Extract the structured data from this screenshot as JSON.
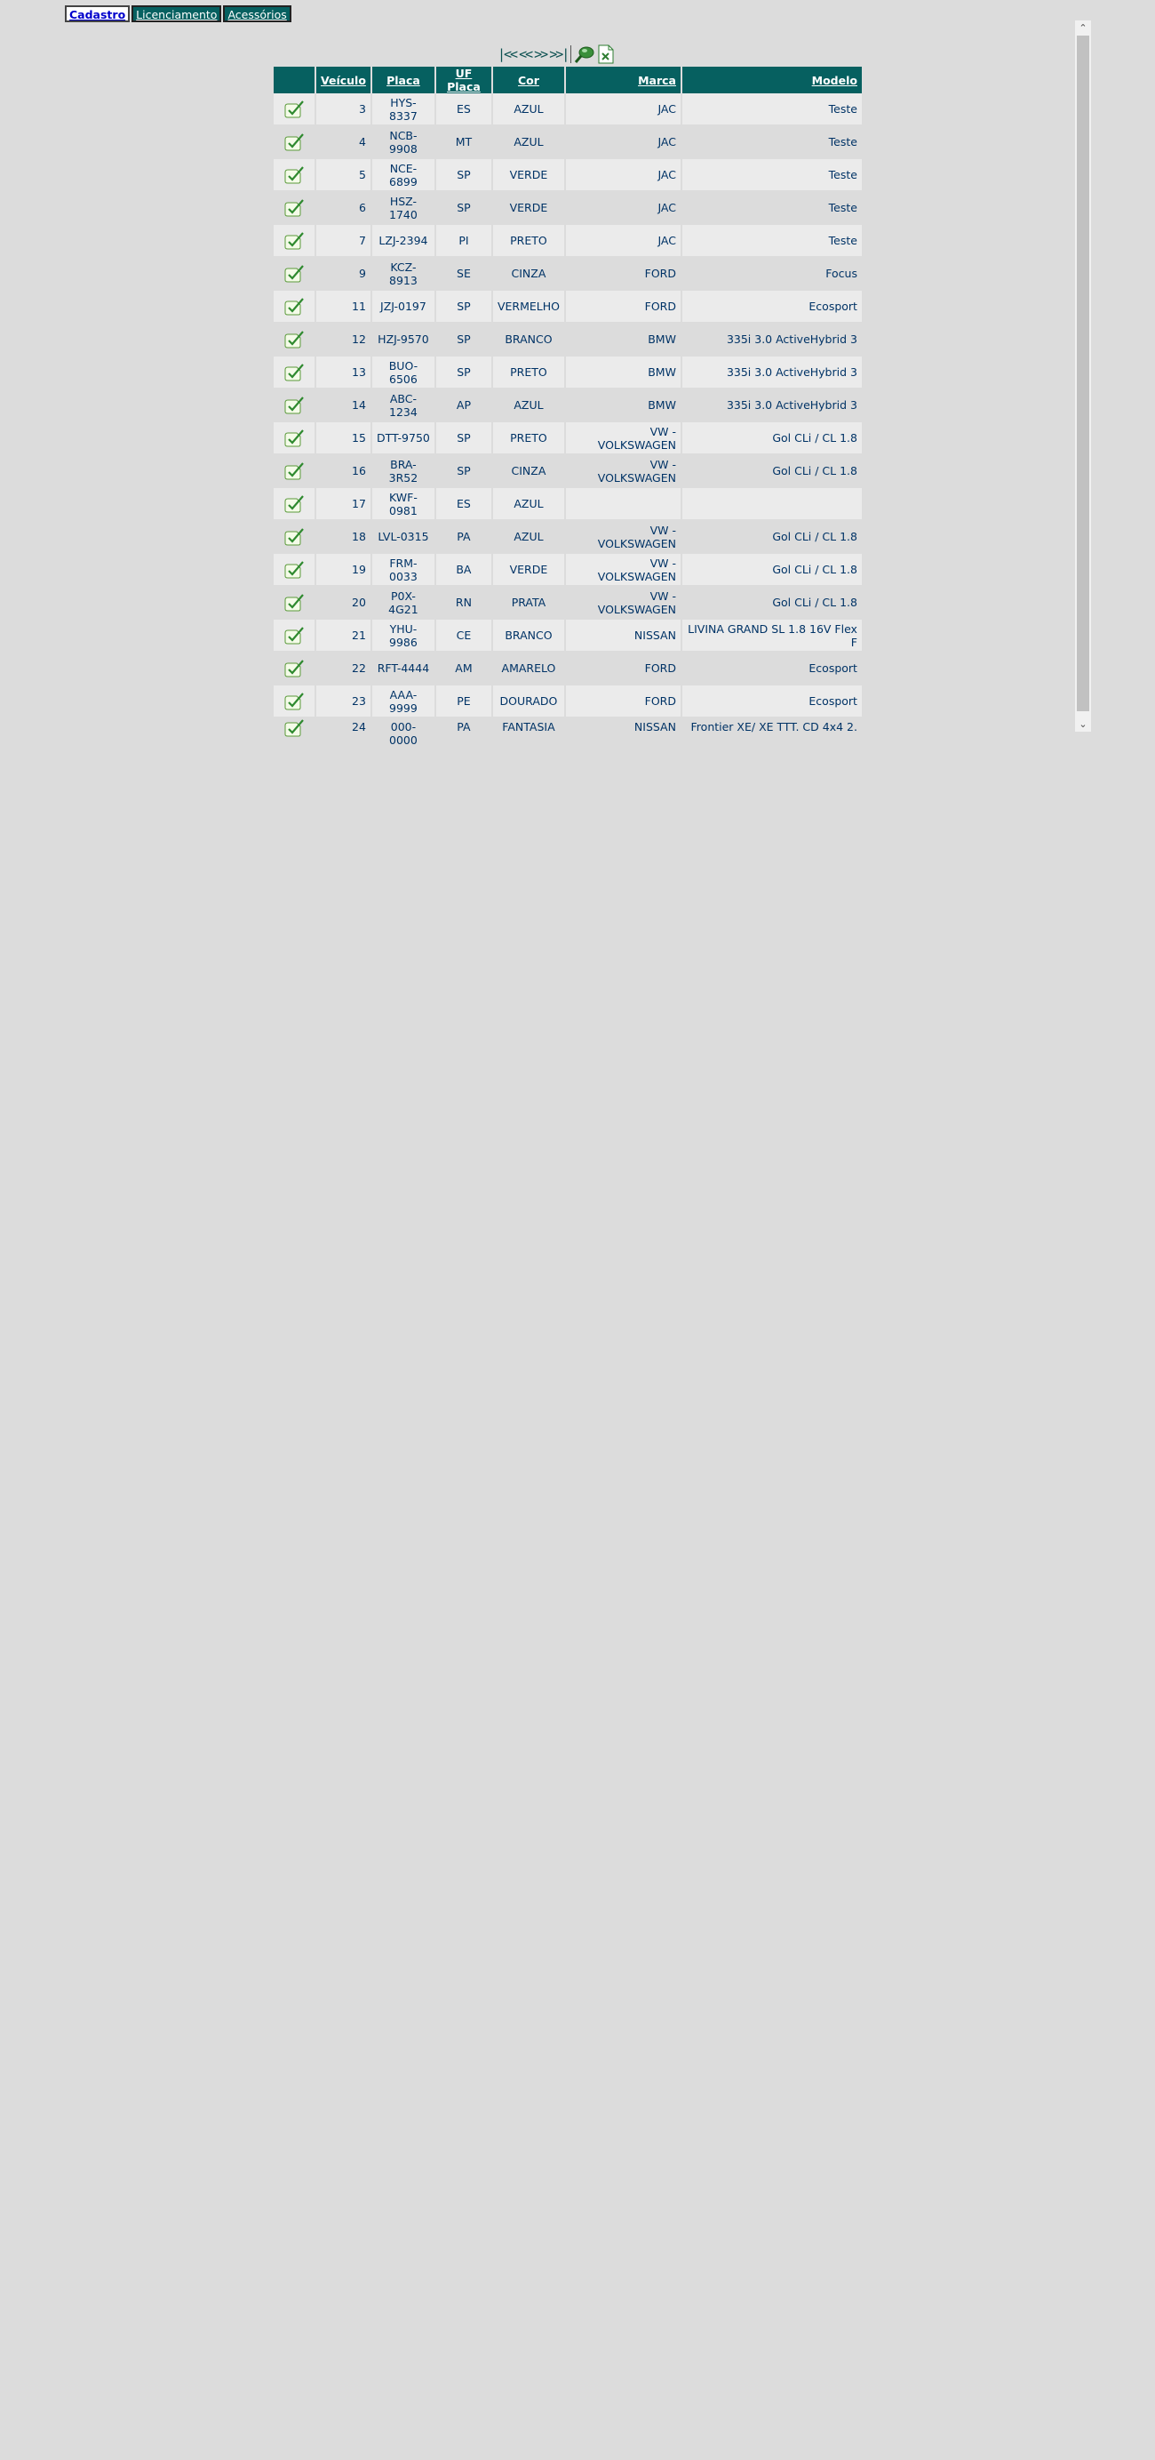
{
  "tabs": [
    {
      "label": "Cadastro",
      "active": true
    },
    {
      "label": "Licenciamento",
      "active": false
    },
    {
      "label": "Acessórios",
      "active": false
    }
  ],
  "pager": {
    "first": "|<<",
    "prev": "<<",
    "next": ">>",
    "last": ">>|",
    "search_icon": "search-icon",
    "export_icon": "excel-export-icon"
  },
  "columns": [
    "",
    "Veículo",
    "Placa",
    "UF Placa",
    "Cor",
    "Marca",
    "Modelo"
  ],
  "rows": [
    {
      "veiculo": "3",
      "placa": "HYS-8337",
      "uf": "ES",
      "cor": "AZUL",
      "marca": "JAC",
      "modelo": "Teste"
    },
    {
      "veiculo": "4",
      "placa": "NCB-9908",
      "uf": "MT",
      "cor": "AZUL",
      "marca": "JAC",
      "modelo": "Teste"
    },
    {
      "veiculo": "5",
      "placa": "NCE-6899",
      "uf": "SP",
      "cor": "VERDE",
      "marca": "JAC",
      "modelo": "Teste"
    },
    {
      "veiculo": "6",
      "placa": "HSZ-1740",
      "uf": "SP",
      "cor": "VERDE",
      "marca": "JAC",
      "modelo": "Teste"
    },
    {
      "veiculo": "7",
      "placa": "LZJ-2394",
      "uf": "PI",
      "cor": "PRETO",
      "marca": "JAC",
      "modelo": "Teste"
    },
    {
      "veiculo": "9",
      "placa": "KCZ-8913",
      "uf": "SE",
      "cor": "CINZA",
      "marca": "FORD",
      "modelo": "Focus"
    },
    {
      "veiculo": "11",
      "placa": "JZJ-0197",
      "uf": "SP",
      "cor": "VERMELHO",
      "marca": "FORD",
      "modelo": "Ecosport"
    },
    {
      "veiculo": "12",
      "placa": "HZJ-9570",
      "uf": "SP",
      "cor": "BRANCO",
      "marca": "BMW",
      "modelo": "335i 3.0 ActiveHybrid 3"
    },
    {
      "veiculo": "13",
      "placa": "BUO-6506",
      "uf": "SP",
      "cor": "PRETO",
      "marca": "BMW",
      "modelo": "335i 3.0 ActiveHybrid 3"
    },
    {
      "veiculo": "14",
      "placa": "ABC-1234",
      "uf": "AP",
      "cor": "AZUL",
      "marca": "BMW",
      "modelo": "335i 3.0 ActiveHybrid 3"
    },
    {
      "veiculo": "15",
      "placa": "DTT-9750",
      "uf": "SP",
      "cor": "PRETO",
      "marca": "VW - VOLKSWAGEN",
      "modelo": "Gol CLi / CL 1.8"
    },
    {
      "veiculo": "16",
      "placa": "BRA-3R52",
      "uf": "SP",
      "cor": "CINZA",
      "marca": "VW - VOLKSWAGEN",
      "modelo": "Gol CLi / CL 1.8"
    },
    {
      "veiculo": "17",
      "placa": "KWF-0981",
      "uf": "ES",
      "cor": "AZUL",
      "marca": "",
      "modelo": ""
    },
    {
      "veiculo": "18",
      "placa": "LVL-0315",
      "uf": "PA",
      "cor": "AZUL",
      "marca": "VW - VOLKSWAGEN",
      "modelo": "Gol CLi / CL 1.8"
    },
    {
      "veiculo": "19",
      "placa": "FRM-0033",
      "uf": "BA",
      "cor": "VERDE",
      "marca": "VW - VOLKSWAGEN",
      "modelo": "Gol CLi / CL 1.8"
    },
    {
      "veiculo": "20",
      "placa": "P0X-4G21",
      "uf": "RN",
      "cor": "PRATA",
      "marca": "VW - VOLKSWAGEN",
      "modelo": "Gol CLi / CL 1.8"
    },
    {
      "veiculo": "21",
      "placa": "YHU-9986",
      "uf": "CE",
      "cor": "BRANCO",
      "marca": "NISSAN",
      "modelo": "LIVINA GRAND SL 1.8 16V Flex F"
    },
    {
      "veiculo": "22",
      "placa": "RFT-4444",
      "uf": "AM",
      "cor": "AMARELO",
      "marca": "FORD",
      "modelo": "Ecosport"
    },
    {
      "veiculo": "23",
      "placa": "AAA-9999",
      "uf": "PE",
      "cor": "DOURADO",
      "marca": "FORD",
      "modelo": "Ecosport"
    },
    {
      "veiculo": "24",
      "placa": "000-0000",
      "uf": "PA",
      "cor": "FANTASIA",
      "marca": "NISSAN",
      "modelo": "Frontier XE/ XE TTT. CD 4x4 2."
    }
  ],
  "colors": {
    "header_bg": "#066060",
    "row_odd": "#ebebeb",
    "row_even": "#dcdcdc",
    "text": "#003366",
    "page_bg": "#dcdcdc"
  }
}
